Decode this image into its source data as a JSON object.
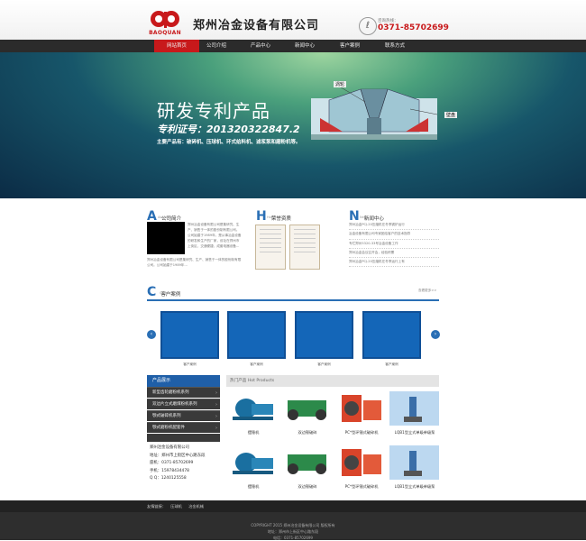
{
  "header": {
    "logo_text": "BAOQUAN",
    "company_name": "郑州冶金设备有限公司",
    "hotline_label": "咨询热线：",
    "hotline_number": "0371-85702699"
  },
  "nav": {
    "items": [
      "网站首页",
      "公司介绍",
      "产品中心",
      "新闻中心",
      "客户案例",
      "联系方式"
    ],
    "active_index": 0
  },
  "banner": {
    "title": "研发专利产品",
    "patent": "专利证号：201320322847.2",
    "products": "主要产品有：破碎机、压球机、环式给料机、滤浆泵和磨粉机等。",
    "label_a": "涡轮",
    "label_b": "壁盘"
  },
  "about": {
    "letter": "A",
    "title": "公司简介",
    "subtitle": "About us",
    "text": "郑州冶金设备有限公司是集研究、生产、销售于一体的股份制有限公司。公司始建于1989年，是从事冶金设备的研发和生产的厂家，设址在郑州市上街区，交通便捷，成套电器设备...",
    "text2": "郑州冶金设备有限公司是集研究、生产、销售于一体的股份制有限公司。公司始建于1989年..."
  },
  "honor": {
    "letter": "H",
    "title": "荣誉资质",
    "subtitle": "Honor"
  },
  "news": {
    "letter": "N",
    "title": "新闻中心",
    "subtitle": "News",
    "items": [
      "郑州冶金PCJ-20压缩机在冬季锅炉运行",
      "冶金设备有限公司专家团给客户的技术指导",
      "专栏郑州5320-33号冶金设备工作",
      "郑州冶金会议召开会，经验积累",
      "郑州冶金PCJ-20压缩机在冬季运行上有"
    ]
  },
  "cases": {
    "letter": "C",
    "title": "客户案例",
    "subtitle": "Case",
    "more": "查看更多>>",
    "items": [
      "客户案例",
      "客户案例",
      "客户案例",
      "客户案例"
    ]
  },
  "sidebar": {
    "heading": "产品展示",
    "items": [
      "新型齿轮磨粉机系列",
      "双边片立式磨煤粉机系列",
      "颚式破碎机系列",
      "颚式磨粉机配套件"
    ],
    "contact": {
      "company": "郑州冶金设备有限公司",
      "address": "地址：郑州市上街区中心路东段",
      "phone": "座机：0371-85702699",
      "mobile": "手机：15978434478",
      "qq": "Q Q：1240125558"
    }
  },
  "products": {
    "heading": "热门产品  Hot Products",
    "row1": [
      "摆锤机",
      "双边颚破碎",
      "PC*型环锤式破碎机",
      "LQB1型立式单级单级泵"
    ],
    "row2": [
      "摆锤机",
      "双边颚破碎",
      "PC*型环锤式破碎机",
      "LQB1型立式单级单级泵"
    ]
  },
  "footer": {
    "links_label": "友情链接：",
    "links": [
      "压球机",
      "冶金机械"
    ],
    "copyright": "COPYRIGHT 2015 郑州冶金设备有限公司 版权所有",
    "address": "地址：郑州市上街区中心路东段",
    "tel": "电话：0371-85702699"
  },
  "colors": {
    "brand_red": "#c8191b",
    "accent_blue": "#2a6fb5",
    "nav_bg": "#2b2b2b"
  }
}
